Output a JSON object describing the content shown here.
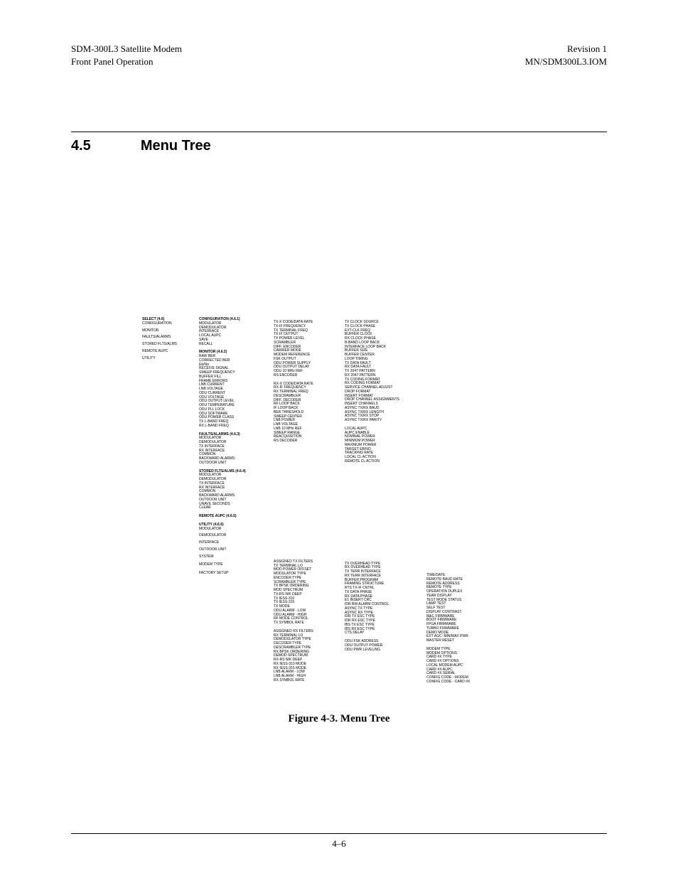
{
  "header": {
    "left1": "SDM-300L3 Satellite Modem",
    "left2": "Front Panel Operation",
    "right1": "Revision 1",
    "right2": "MN/SDM300L3.IOM"
  },
  "section": {
    "num": "4.5",
    "title": "Menu Tree"
  },
  "caption": "Figure 4-3.  Menu Tree",
  "footer": "4–6",
  "col1": {
    "title": "SELECT (4.6)",
    "items": [
      "CONFIGURATION",
      "MONITOR",
      "FAULTS/ALARMS",
      "STORED FLTS/ALMS",
      "REMOTE AUPC",
      "UTILITY"
    ]
  },
  "col2": {
    "config": {
      "title": "CONFIGURATION (4.6.1)",
      "items": [
        "MODULATOR",
        "DEMODULATOR",
        "INTERFACE",
        "LOCAL AUPC",
        "SAVE",
        "RECALL"
      ]
    },
    "monitor": {
      "title": "MONITOR (4.6.2)",
      "items": [
        "RAW BER",
        "CORRECTED BER",
        "Eb/No",
        "RECEIVE SIGNAL",
        "SWEEP FREQUENCY",
        "BUFFER FILL",
        "FRAME ERRORS",
        "LNB CURRENT",
        "LNB VOLTAGE",
        "ODU CURRENT",
        "ODU VOLTAGE",
        "ODU OUTPUT LEVEL",
        "ODU TEMPERATURE",
        "ODU PLL LOCK",
        "ODU SOFTWARE",
        "ODU POWER CLASS",
        "TX L-BAND FREQ",
        "RX L-BAND FREQ"
      ]
    },
    "faults": {
      "title": "FAULTS/ALARMS (4.6.3)",
      "items": [
        "MODULATOR",
        "DEMODULATOR",
        "TX INTERFACE",
        "RX INTERFACE",
        "COMMON",
        "BACKWARD ALARMS",
        "OUTDOOR UNIT"
      ]
    },
    "stored": {
      "title": "STORED FLTS/ALMS (4.6.4)",
      "items": [
        "MODULATOR",
        "DEMODULATOR",
        "TX INTERFACE",
        "RX INTERFACE",
        "COMMON",
        "BACKWARD ALARMS",
        "OUTDOOR UNIT",
        "UNAVIL SECONDS",
        "CLEAR"
      ]
    },
    "remote": {
      "title": "REMOTE AUPC (4.6.5)"
    },
    "utility": {
      "title": "UTILITY (4.6.6)",
      "items": [
        "MODULATOR",
        "DEMODULATOR",
        "INTERFACE",
        "OUTDOOR UNIT",
        "SYSTEM",
        "MODEM TYPE",
        "FACTORY SETUP"
      ]
    }
  },
  "col3": {
    "mod": [
      "TX-X CODE/DATA RATE",
      "TX-IF FREQUENCY",
      "TX TERMINAL FREQ",
      "TX-IF OUTPUT",
      "TX POWER LEVEL",
      "SCRAMBLER",
      "DIFF. ENCODER",
      "CARRIER MODE",
      "MODEM REFERENCE",
      "FSK OUTPUT",
      "ODU POWER SUPPLY",
      "ODU OUTPUT DELAY",
      "ODU 10 MHz REF",
      "RS ENCODER"
    ],
    "demod": [
      "RX-X CODE/DATA RATE",
      "RX-IF FREQUENCY",
      "RX TERMINAL FREQ",
      "DESCRAMBLER",
      "DIFF. DECODER",
      "RF LOOP BACK",
      "IF LOOP BACK",
      "BER THRESHOLD",
      "SWEEP CENTER",
      "LNB POWER",
      "LNB VOLTAGE",
      "LNB 10 MHz REF",
      "SWEEP RANGE",
      "REACQUISITION",
      "RS DECODER"
    ],
    "util_mod": [
      "ASSIGNED TX FILTERS",
      "TX TERMINAL LO",
      "MOD POWER OFFSET",
      "MODULATOR TYPE",
      "ENCODER TYPE",
      "SCRAMBLER TYPE",
      "TX BPSK ORDERING",
      "MOD SPECTRUM",
      "TX-RS N/K DEEP",
      "TX IESS-310",
      "TX IESS-315",
      "TX MODE",
      "ODU ALARM - LOW",
      "ODU ALARM - HIGH",
      "RF MODE CONTROL",
      "TX SYMBOL RATE"
    ],
    "util_dem": [
      "ASSIGNED RX FILTERS",
      "RX TERMINAL LO",
      "DEMODULATOR TYPE",
      "DECODER TYPE",
      "DESCRAMBLER TYPE",
      "RX BPSK ORDERING",
      "DEMOD SPECTRUM",
      "RX-RS N/K DEEP",
      "RX IESS-310 MODE",
      "RX IESS-315 MODE",
      "LNB ALARM - LOW",
      "LNB ALARM - HIGH",
      "RX SYMBOL RATE"
    ]
  },
  "col4": {
    "iface": [
      "TX CLOCK SOURCE",
      "TX CLOCK PHASE",
      "EXT-CLK FREQ",
      "BUFFER CLOCK",
      "RX CLOCK PHASE",
      "B-BAND LOOP BACK",
      "INTERFACE LOOP BACK",
      "BUFFER SIZE",
      "BUFFER CENTER",
      "LOOP TIMING",
      "TX DATA FAULT",
      "RX DATA FAULT",
      "TX 2047 PATTERN",
      "RX 2047 PATTERN",
      "TX CODING FORMAT",
      "RX CODING FORMAT",
      "SERVICE CHANNEL ADJUST",
      "DROP FORMAT",
      "INSERT FORMAT",
      "DROP CHANNEL ASSIGNMENTS",
      "INSERT CHANNELS",
      "ASYNC TX/RX BAUD",
      "ASYNC TX/RX LENGTH",
      "ASYNC TX/RX STOP",
      "ASYNC TX/RX PARITY"
    ],
    "aupc": [
      "LOCAL AUPC",
      "AUPC ENABLE",
      "NOMINAL POWER",
      "MINIMUM POWER",
      "MAXIMUM POWER",
      "TARGET EB/NO",
      "TRACKING RATE",
      "LOCAL CL ACTION",
      "REMOTE CL ACTION"
    ],
    "util_iface": [
      "TX OVERHEAD TYPE",
      "RX OVERHEAD TYPE",
      "TX TERR INTERFACE",
      "RX TERR INTERFACE",
      "BUFFER PROGRAM",
      "FRAMING STRUCTURE",
      "RTS TX-IF CNTRL",
      "TX DATA PHASE",
      "RX DATA PHASE",
      "E1 INSERT CRC",
      "IDR BW ALARM CONTROL",
      "ASYNC TX TYPE",
      "ASYNC RX TYPE",
      "IDR TX ESC TYPE",
      "IDR RX ESC TYPE",
      "IBS TX ESC TYPE",
      "IBS RX ESC TYPE",
      "CTS DELAY"
    ],
    "odu": [
      "ODU FSK ADDRESS",
      "ODU OUTPUT POWER",
      "ODU PWR LEVELING"
    ]
  },
  "col5": {
    "system": [
      "TIME/DATE",
      "REMOTE BAUD RATE",
      "REMOTE ADDRESS",
      "REMOTE TYPE",
      "OPERATION DUPLEX",
      "YEAR DISPLAY",
      "TEST MODE STATUS",
      "LAMP TEST",
      "SELF TEST",
      "DISPLAY CONTRAST",
      "M&C FIRMWARE",
      "BOOT FIRMWARE",
      "FPGA FIRMWARE",
      "TURBO FIRMWARE",
      "DEMO MODE",
      "EXT AGC: MIN/MAX PWR",
      "MASTER RESET"
    ],
    "modem_type": [
      "MODEM TYPE",
      "MODEM OPTIONS",
      "CARD #X TYPE",
      "CARD #X OPTIONS",
      "LOCAL MODEM AUPC",
      "CARD #X AUPC",
      "CARD #X SERIAL",
      "CONFIG CODE - MODEM",
      "CONFIG CODE - CARD #X"
    ]
  }
}
